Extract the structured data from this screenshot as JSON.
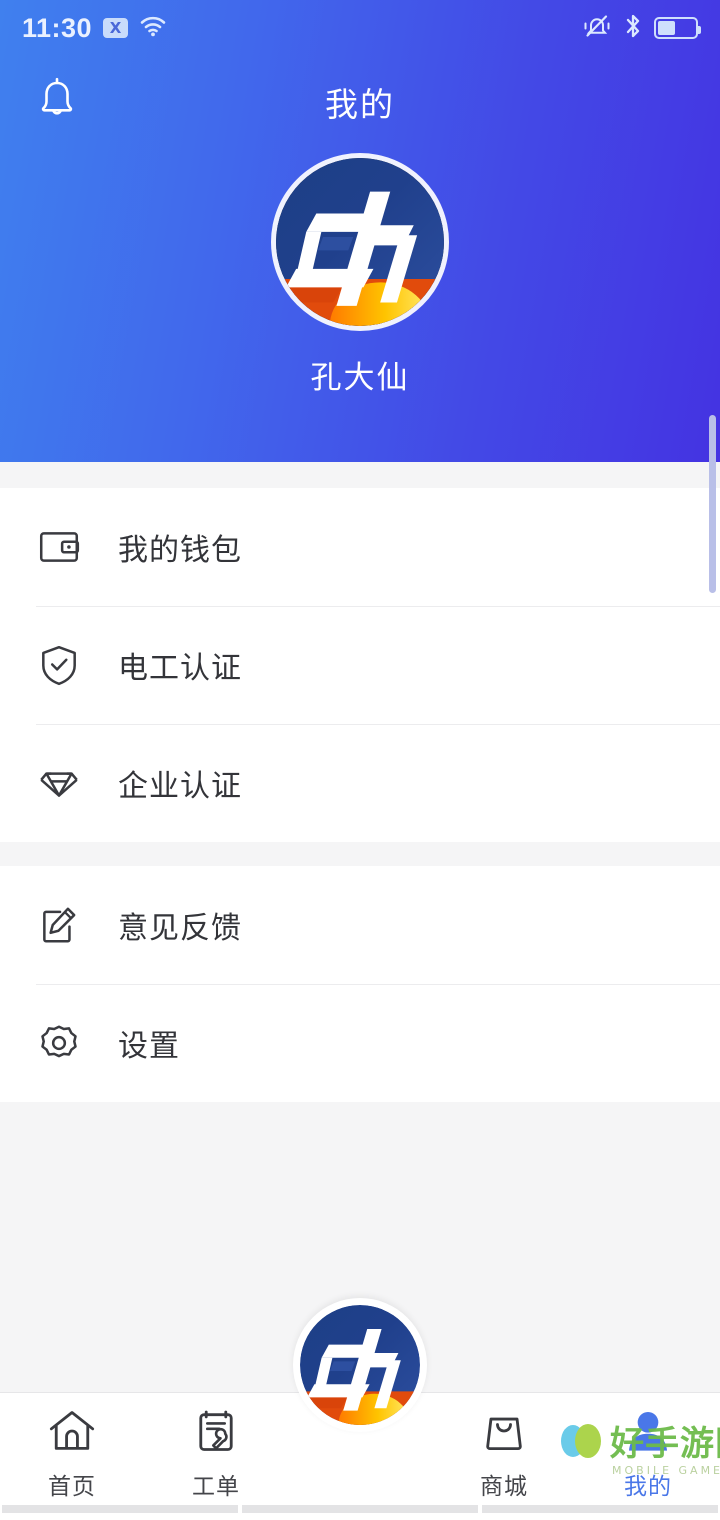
{
  "status_bar": {
    "time": "11:30",
    "no_sim_label": "X",
    "icons": [
      "no-sim-icon",
      "wifi-icon",
      "vibrate-mute-icon",
      "bluetooth-icon",
      "battery-icon"
    ],
    "battery_percent": 48
  },
  "header": {
    "title": "我的",
    "bell_icon": "bell-icon",
    "gradient_from": "#4080ee",
    "gradient_to": "#4433e2",
    "avatar_alt": "电 logo avatar",
    "user_name": "孔大仙"
  },
  "menu": {
    "groups": [
      {
        "items": [
          {
            "icon": "wallet-icon",
            "label": "我的钱包"
          },
          {
            "icon": "shield-check-icon",
            "label": "电工认证"
          },
          {
            "icon": "diamond-icon",
            "label": "企业认证"
          }
        ]
      },
      {
        "items": [
          {
            "icon": "edit-note-icon",
            "label": "意见反馈"
          },
          {
            "icon": "gear-icon",
            "label": "设置"
          }
        ]
      }
    ]
  },
  "tabbar": {
    "active_index": 4,
    "active_color": "#4a77e8",
    "inactive_color": "#44454a",
    "items": [
      {
        "icon": "home-icon",
        "label": "首页"
      },
      {
        "icon": "work-order-icon",
        "label": "工单"
      },
      {
        "icon": "logo-fab-icon",
        "label": ""
      },
      {
        "icon": "shopping-bag-icon",
        "label": "商城"
      },
      {
        "icon": "person-icon",
        "label": "我的"
      }
    ]
  },
  "watermark": {
    "text": "好手游网",
    "subtext": "MOBILE GAMES"
  }
}
